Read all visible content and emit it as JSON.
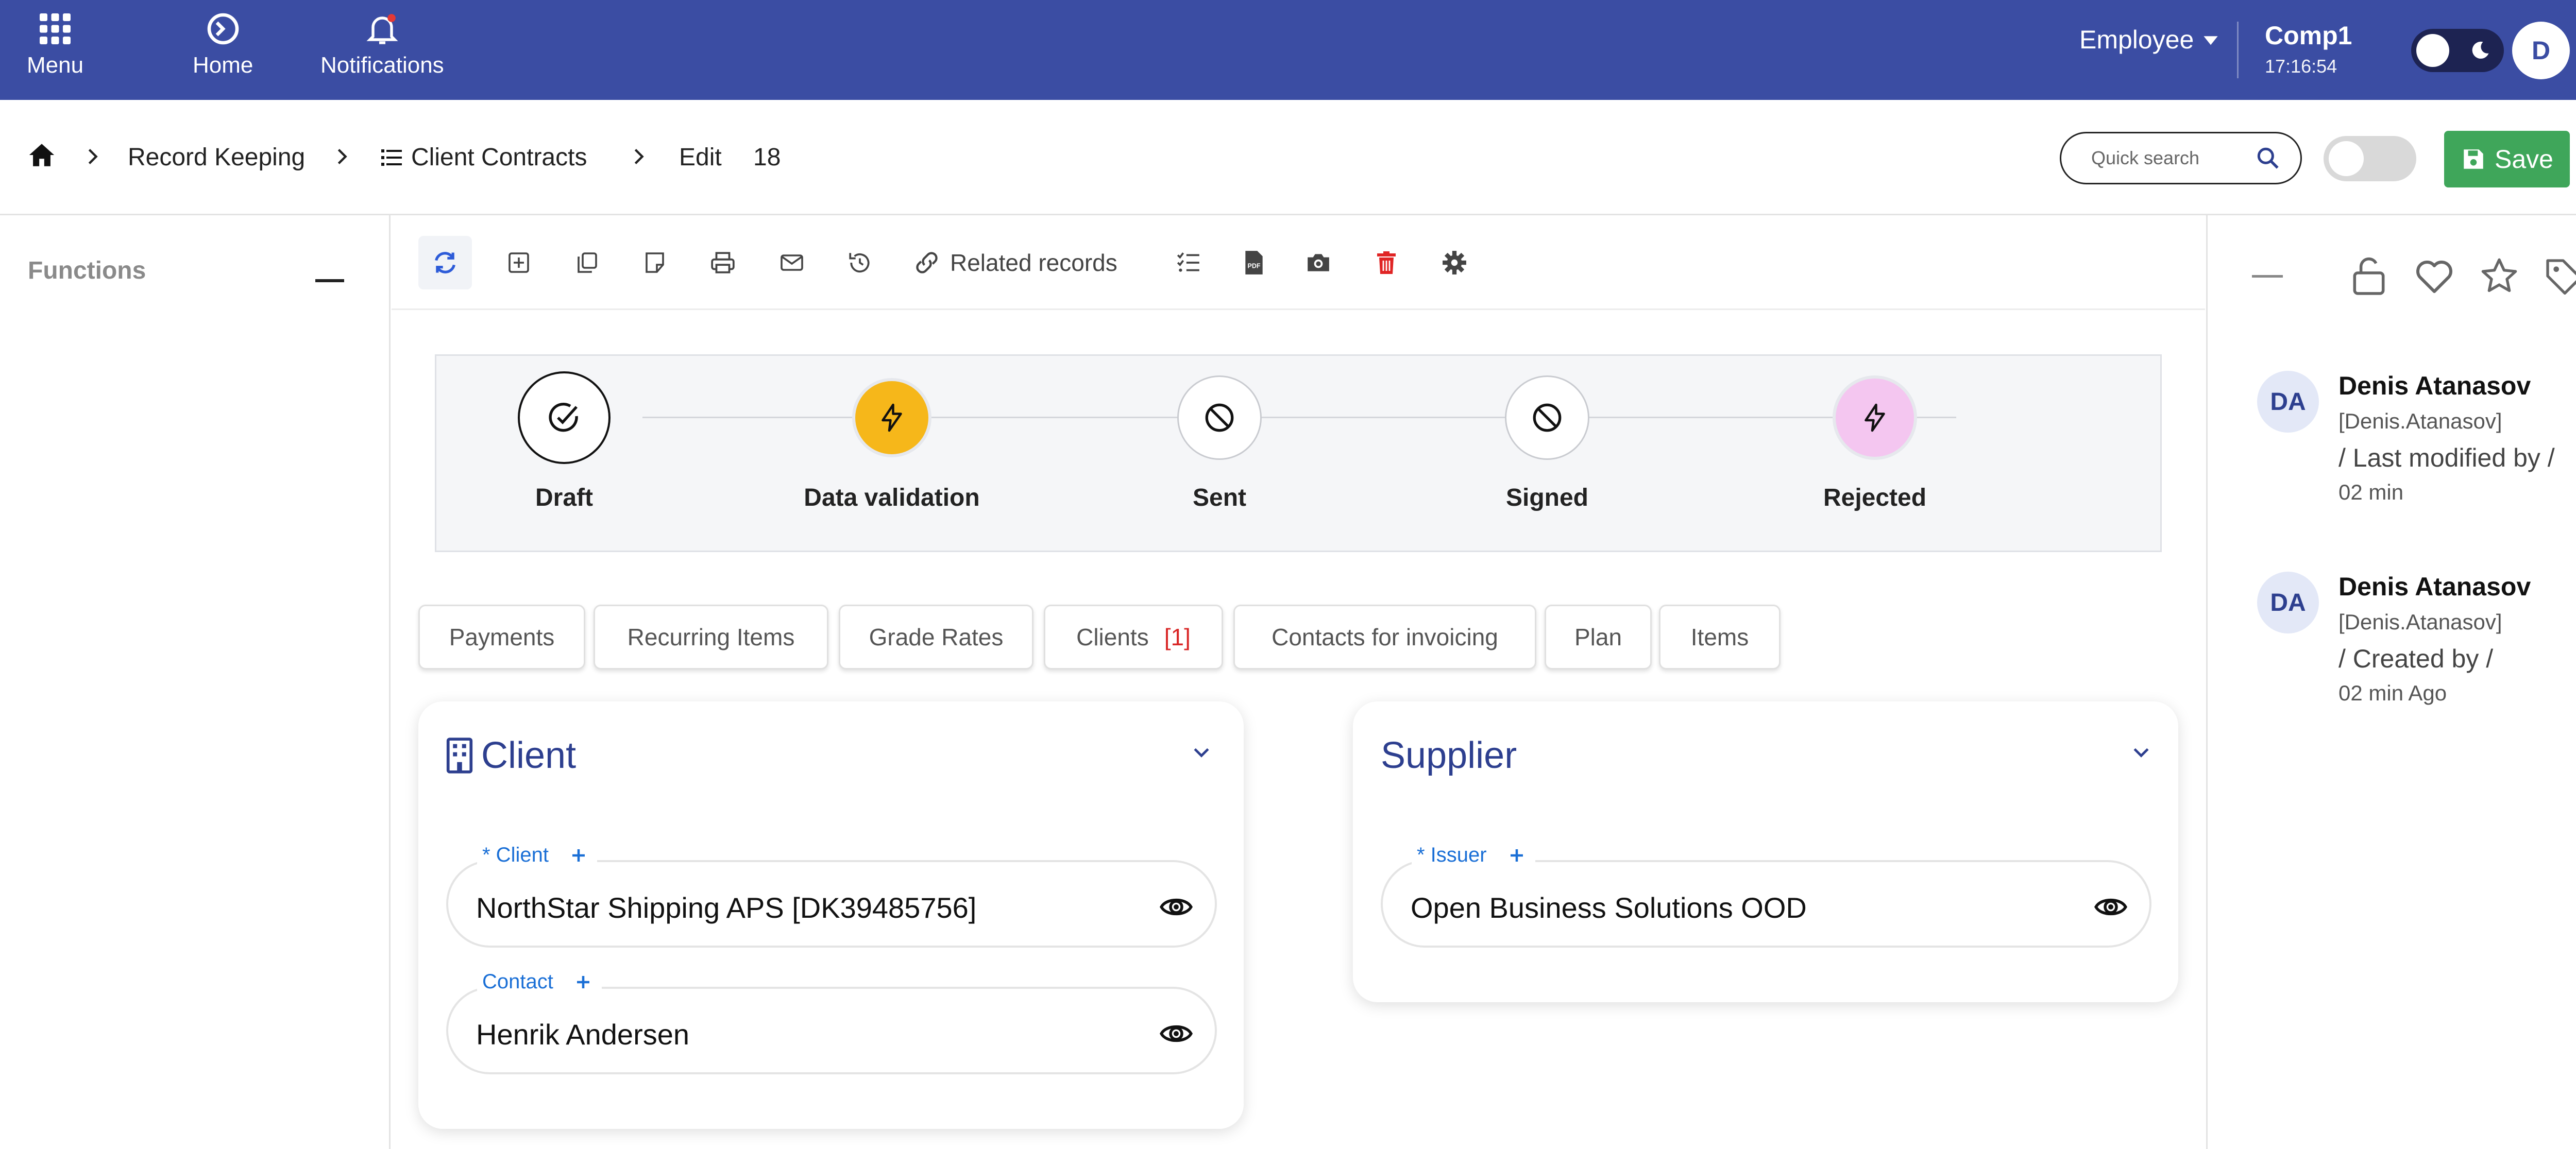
{
  "topbar": {
    "menu_label": "Menu",
    "home_label": "Home",
    "notifications_label": "Notifications",
    "role": "Employee",
    "company": "Comp1",
    "time": "17:16:54",
    "user_initial": "D",
    "bg_color": "#3b4da3"
  },
  "breadcrumb": {
    "section": "Record Keeping",
    "module": "Client Contracts",
    "action": "Edit",
    "record_id": "18"
  },
  "search": {
    "placeholder": "Quick search"
  },
  "save_button": {
    "label": "Save",
    "color": "#3fa65a"
  },
  "sidebar": {
    "title": "Functions"
  },
  "toolbar": {
    "related_label": "Related records",
    "icons": [
      "refresh-icon",
      "new-record-icon",
      "copy-icon",
      "note-icon",
      "print-icon",
      "email-icon",
      "history-icon",
      "link-icon",
      "checklist-icon",
      "pdf-icon",
      "camera-icon",
      "delete-icon",
      "settings-icon"
    ]
  },
  "workflow": {
    "steps": [
      {
        "label": "Draft",
        "state": "completed"
      },
      {
        "label": "Data validation",
        "state": "current"
      },
      {
        "label": "Sent",
        "state": "blocked"
      },
      {
        "label": "Signed",
        "state": "blocked"
      },
      {
        "label": "Rejected",
        "state": "available"
      }
    ],
    "current_color": "#f6b71a",
    "rejected_color": "#f4c6f0"
  },
  "tabs": [
    {
      "label": "Payments"
    },
    {
      "label": "Recurring Items"
    },
    {
      "label": "Grade Rates"
    },
    {
      "label": "Clients",
      "count": "[1]"
    },
    {
      "label": "Contacts for invoicing"
    },
    {
      "label": "Plan"
    },
    {
      "label": "Items"
    }
  ],
  "client_card": {
    "title": "Client",
    "client_label": "* Client",
    "client_value": "NorthStar Shipping APS [DK39485756]",
    "contact_label": "Contact",
    "contact_value": "Henrik Andersen"
  },
  "supplier_card": {
    "title": "Supplier",
    "issuer_label": "* Issuer",
    "issuer_value": "Open Business Solutions OOD"
  },
  "right_panel": {
    "icons": [
      "minimize-icon",
      "unlock-icon",
      "heart-icon",
      "star-icon",
      "tag-icon"
    ],
    "activity": [
      {
        "initials": "DA",
        "name": "Denis Atanasov",
        "login": "[Denis.Atanasov]",
        "action": "/ Last modified by /",
        "when": "02 min"
      },
      {
        "initials": "DA",
        "name": "Denis Atanasov",
        "login": "[Denis.Atanasov]",
        "action": "/ Created by /",
        "when": "02 min Ago"
      }
    ]
  },
  "accent_color": "#1a6fd6",
  "title_color": "#2d3f8f"
}
